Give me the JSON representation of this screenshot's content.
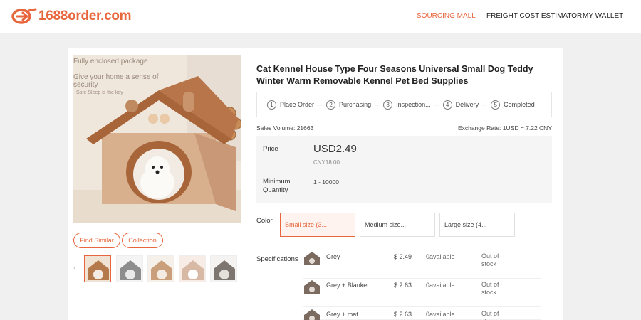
{
  "header": {
    "logo_text": "1688order.com",
    "nav": [
      {
        "label": "SOURCING MALL",
        "active": true
      },
      {
        "label": "FREIGHT COST ESTIMATOR",
        "active": false
      },
      {
        "label": "MY WALLET",
        "active": false
      }
    ]
  },
  "product": {
    "image_overlay": {
      "line1": "Fully enclosed package",
      "line2": "Give your home a sense of security",
      "line3": "Safe Sleep is the key"
    },
    "buttons": {
      "find_similar": "Find Similar",
      "collection": "Collection"
    },
    "thumb_arrow": "‹",
    "title": "Cat Kennel House Type Four Seasons Universal Small Dog Teddy Winter Warm Removable Kennel Pet Bed Supplies",
    "steps": [
      {
        "num": "1",
        "label": "Place Order"
      },
      {
        "num": "2",
        "label": "Purchasing"
      },
      {
        "num": "3",
        "label": "Inspection..."
      },
      {
        "num": "4",
        "label": "Delivery"
      },
      {
        "num": "5",
        "label": "Completed"
      }
    ],
    "step_separator": "–",
    "sales_volume": "Sales Volume:  21663",
    "exchange_rate": "Exchange Rate: 1USD = 7.22 CNY",
    "price": {
      "label": "Price",
      "usd": "USD2.49",
      "cny": "CNY18.00",
      "min_qty_label": "Minimum Quantity",
      "min_qty_value": "1 - 10000"
    },
    "color": {
      "label": "Color",
      "options": [
        {
          "label": "Small size (3...",
          "selected": true
        },
        {
          "label": "Medium size...",
          "selected": false
        },
        {
          "label": "Large size (4...",
          "selected": false
        }
      ]
    },
    "specifications": {
      "label": "Specifications",
      "rows": [
        {
          "name": "Grey",
          "price": "$ 2.49",
          "available": "0available",
          "stock": "Out of stock"
        },
        {
          "name": "Grey + Blanket",
          "price": "$ 2.63",
          "available": "0available",
          "stock": "Out of stock"
        },
        {
          "name": "Grey + mat",
          "price": "$ 2.63",
          "available": "0available",
          "stock": "Out of stock"
        }
      ]
    }
  },
  "colors": {
    "brand": "#e8663d",
    "background": "#f0f0f0"
  }
}
